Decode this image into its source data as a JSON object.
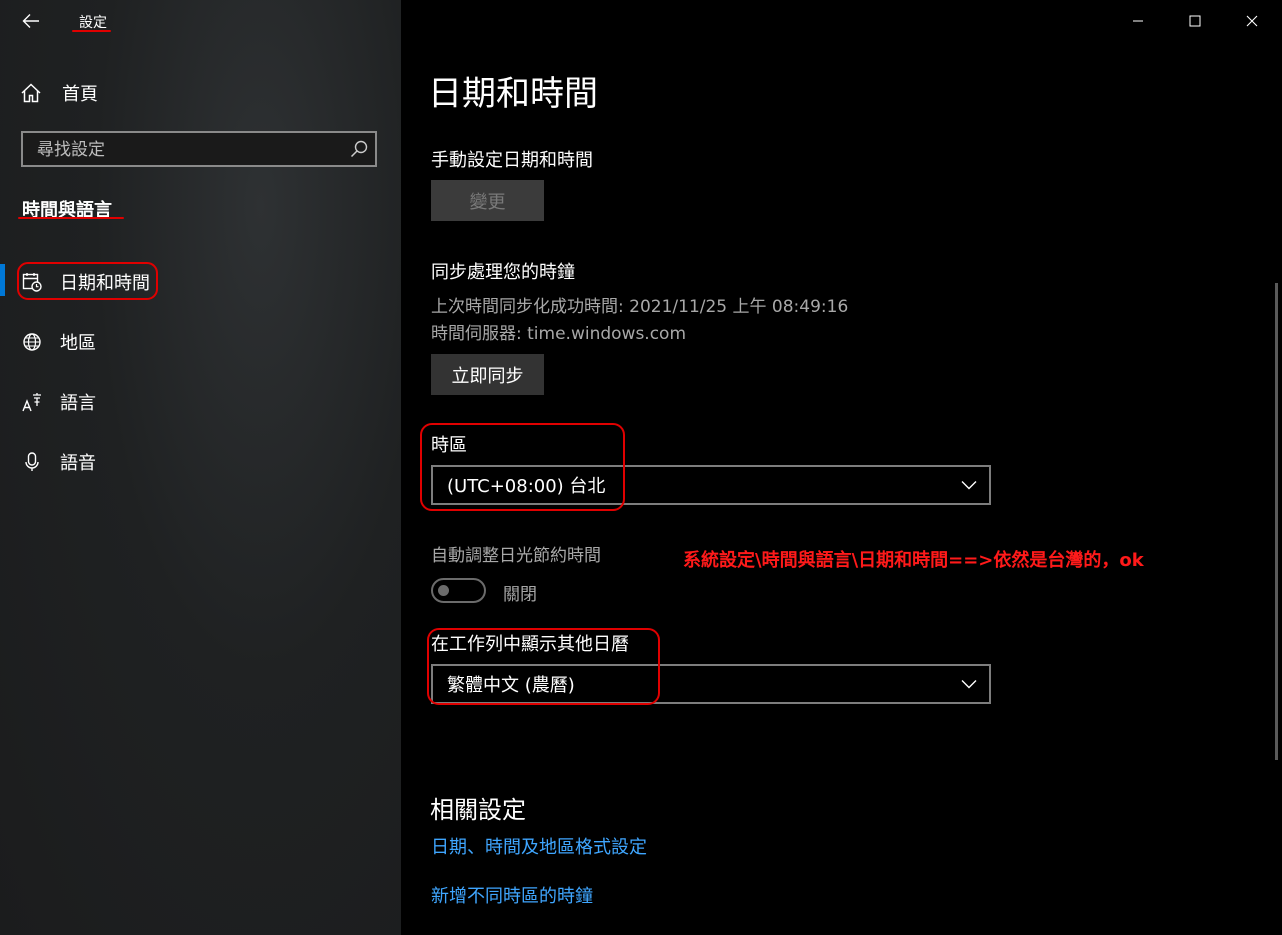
{
  "window": {
    "app_title": "設定",
    "controls": {
      "minimize": "minimize",
      "maximize": "maximize",
      "close": "close"
    }
  },
  "sidebar": {
    "home_label": "首頁",
    "search_placeholder": "尋找設定",
    "section_label": "時間與語言",
    "items": [
      {
        "label": "日期和時間",
        "icon": "calendar-clock-icon",
        "active": true
      },
      {
        "label": "地區",
        "icon": "globe-icon",
        "active": false
      },
      {
        "label": "語言",
        "icon": "language-icon",
        "active": false
      },
      {
        "label": "語音",
        "icon": "microphone-icon",
        "active": false
      }
    ]
  },
  "main": {
    "page_title": "日期和時間",
    "manual": {
      "label": "手動設定日期和時間",
      "button": "變更"
    },
    "sync": {
      "label": "同步處理您的時鐘",
      "last_sync": "上次時間同步化成功時間: 2021/11/25 上午 08:49:16",
      "server": "時間伺服器: time.windows.com",
      "button": "立即同步"
    },
    "timezone": {
      "label": "時區",
      "value": "(UTC+08:00) 台北"
    },
    "dst": {
      "label": "自動調整日光節約時間",
      "state": "關閉"
    },
    "calendar": {
      "label": "在工作列中顯示其他日曆",
      "value": "繁體中文 (農曆)"
    },
    "related": {
      "title": "相關設定",
      "links": [
        "日期、時間及地區格式設定",
        "新增不同時區的時鐘"
      ]
    }
  },
  "annotation": {
    "text": "系統設定\\時間與語言\\日期和時間==>依然是台灣的，ok"
  },
  "colors": {
    "accent": "#0078d7",
    "link": "#3fa6ff",
    "annotation": "#e00000"
  }
}
